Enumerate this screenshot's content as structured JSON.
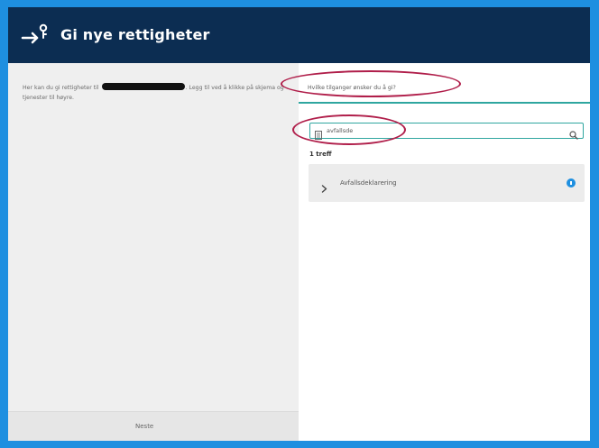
{
  "header": {
    "title": "Gi nye rettigheter",
    "icon": "person-arrow-icon",
    "background": "#0c2d52"
  },
  "left": {
    "intro_pre": "Her kan du gi rettigheter til",
    "intro_post": ". Legg til ved å klikke på skjema og tjenester til høyre.",
    "next_label": "Neste"
  },
  "right": {
    "help_link": "Hvilke tilganger ønsker du å gi?",
    "search": {
      "value": "avfallsde",
      "placeholder": ""
    },
    "results_count": "1 treff",
    "results": [
      {
        "label": "Avfallsdeklarering",
        "icon": "info-icon"
      }
    ]
  },
  "colors": {
    "frame_border": "#1e8fe0",
    "accent_teal": "#2fa6a0",
    "annotation": "#b01e4a"
  }
}
